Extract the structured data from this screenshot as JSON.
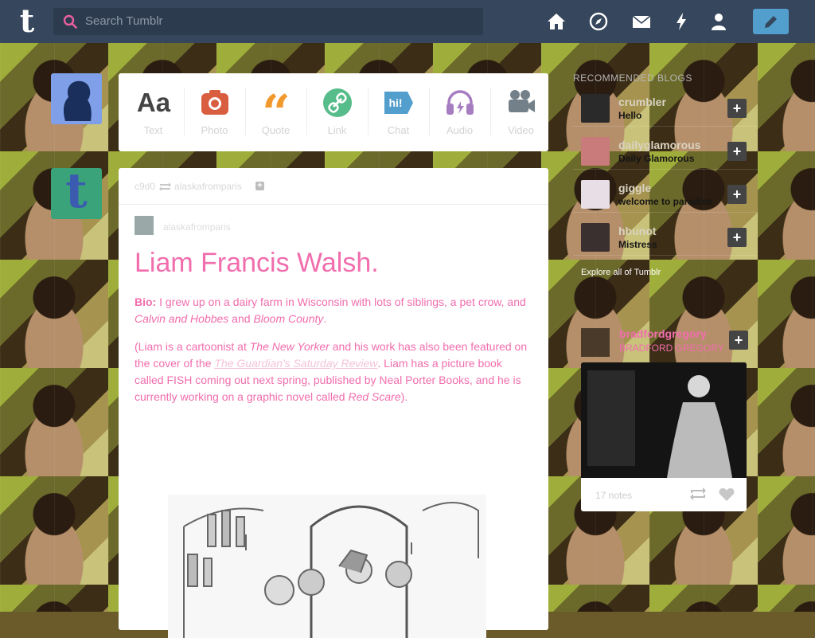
{
  "header": {
    "logo": "t",
    "search_placeholder": "Search Tumblr",
    "nav": [
      "home-icon",
      "explore-compass-icon",
      "inbox-mail-icon",
      "activity-bolt-icon",
      "account-person-icon"
    ],
    "accent": "#529ecc",
    "bar_color": "#36465d"
  },
  "post_types": [
    {
      "label": "Text",
      "icon": "text-aa-icon",
      "color": "#444444"
    },
    {
      "label": "Photo",
      "icon": "camera-icon",
      "color": "#d95e40"
    },
    {
      "label": "Quote",
      "icon": "quote-icon",
      "color": "#f2992e"
    },
    {
      "label": "Link",
      "icon": "link-icon",
      "color": "#56bc8a"
    },
    {
      "label": "Chat",
      "icon": "chat-hi-icon",
      "color": "#529ecc"
    },
    {
      "label": "Audio",
      "icon": "headphones-icon",
      "color": "#a77dc2"
    },
    {
      "label": "Video",
      "icon": "video-camera-icon",
      "color": "#748089"
    }
  ],
  "post": {
    "reblogger": "c9d0",
    "source_blog": "alaskafromparis",
    "source_user": "alaskafromparis",
    "title": "Liam Francis Walsh.",
    "bio_label": "Bio:",
    "bio_text_1": " I grew up on a dairy farm in Wisconsin with lots of siblings, a pet crow, and ",
    "bio_em_1": "Calvin and Hobbes",
    "bio_mid": " and ",
    "bio_em_2": "Bloom County",
    "bio_end": ".",
    "p2_a": "(Liam is a cartoonist at ",
    "p2_em_1": "The New Yorker",
    "p2_b": " and his work has also been featured on the cover of the ",
    "p2_link": "The Guardian's Saturday Review",
    "p2_c": ". Liam has a picture book called FISH coming out next spring, published by Neal Porter Books, and he is currently working on a graphic novel called ",
    "p2_em_2": "Red Scare",
    "p2_d": ").",
    "text_color": "#f16dad"
  },
  "sidebar": {
    "heading": "RECOMMENDED BLOGS",
    "blogs": [
      {
        "name": "crumbler",
        "title": "Hello"
      },
      {
        "name": "dailyglamorous",
        "title": "Daily Glamorous"
      },
      {
        "name": "giggle",
        "title": "welcome to paradise"
      },
      {
        "name": "hbunot",
        "title": "Mistress"
      }
    ],
    "explore": "Explore all of Tumblr",
    "radar": {
      "name": "bradfordgregory",
      "title": "BRADFORD GREGORY",
      "notes": "17 notes"
    }
  }
}
